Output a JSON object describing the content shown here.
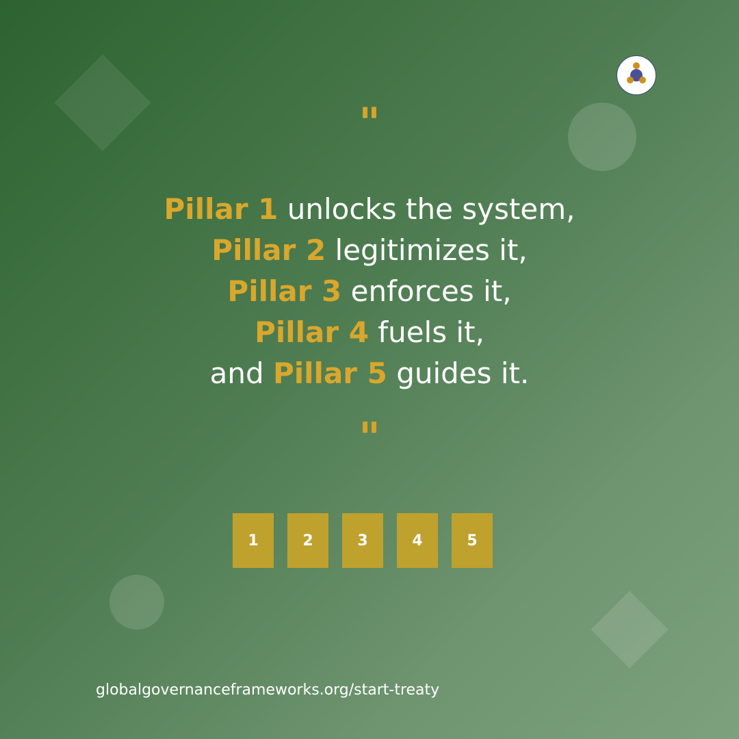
{
  "colors": {
    "accent_gold": "#d9a72c",
    "box_gold": "#bfa12e",
    "text": "#ffffff",
    "bg_start": "#2d6330",
    "bg_end": "#7ea17d"
  },
  "logo": {
    "icon": "three-people-network-icon"
  },
  "quote": {
    "open_mark": "\"",
    "close_mark": "\"",
    "lines": [
      {
        "prefix": "",
        "pillar": "Pillar 1",
        "rest": " unlocks the system,"
      },
      {
        "prefix": "",
        "pillar": "Pillar 2",
        "rest": " legitimizes it,"
      },
      {
        "prefix": "",
        "pillar": "Pillar 3",
        "rest": " enforces it,"
      },
      {
        "prefix": "",
        "pillar": "Pillar 4",
        "rest": " fuels it,"
      },
      {
        "prefix": "and ",
        "pillar": "Pillar 5",
        "rest": " guides it."
      }
    ]
  },
  "pillars": [
    "1",
    "2",
    "3",
    "4",
    "5"
  ],
  "footer": {
    "url": "globalgovernanceframeworks.org/start-treaty"
  }
}
